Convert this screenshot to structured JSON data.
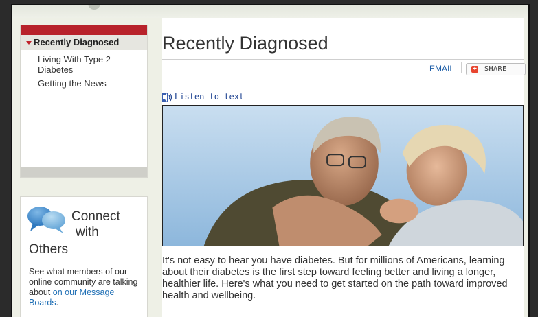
{
  "nav": {
    "active_label": "Recently Diagnosed",
    "items": [
      {
        "label": "Living With Type 2 Diabetes"
      },
      {
        "label": "Getting the News"
      }
    ]
  },
  "connect": {
    "title_line1": "Connect",
    "title_line2": "with",
    "title_line3": "Others",
    "desc_prefix": "See what members of our online community are talking about ",
    "desc_link": "on our Message Boards",
    "desc_suffix": "."
  },
  "main": {
    "title": "Recently Diagnosed",
    "email_label": "EMAIL",
    "share_label": "SHARE",
    "listen_label": "Listen to text",
    "intro": "It's not easy to hear you have diabetes. But for millions of Americans, learning about their diabetes is the first step toward feeling better and living a longer, healthier life. Here's what you need to get started on the path toward improved health and wellbeing."
  },
  "colors": {
    "accent_red": "#b8222b",
    "link_blue": "#1f6fb5",
    "page_background": "#eef0e6"
  }
}
